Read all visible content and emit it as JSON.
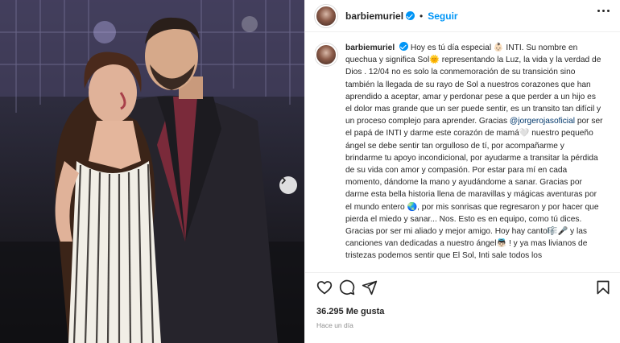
{
  "post": {
    "username": "barbiemuriel",
    "follow_label": "Seguir",
    "dot": "•",
    "caption_before_mention": "Hoy es tú día especial 👶🏻 INTI. Su nombre en quechua y significa Sol🌞 representando la Luz, la vida y la verdad de Dios . 12/04 no es solo la conmemoración de su transición sino también la llegada de su rayo de Sol a nuestros corazones que han aprendido a aceptar, amar y perdonar pese a que perder a un hijo es el dolor mas grande que un ser puede sentir, es un transito tan difícil y un proceso complejo para aprender. Gracias ",
    "mention": "@jorgerojasoficial",
    "caption_after_mention": " por ser el papá de INTI y darme este corazón de mamá🤍 nuestro pequeño ángel se debe sentir tan orgulloso de tí, por acompañarme y brindarme tu apoyo incondicional, por ayudarme a transitar la pérdida de su vida con amor y compasión. Por estar para mí en cada momento, dándome la mano y ayudándome a sanar. Gracias por darme esta bella historia llena de maravillas y mágicas aventuras por el mundo entero 🌏, por mis sonrisas que regresaron y por hacer que pierda el miedo y sanar... Nos. Esto es en equipo, como tú dices. Gracias por ser mi aliado y mejor amigo. Hoy hay canto🎼🎤 y las canciones van dedicadas a nuestro ángel👼🏻 ! y ya mas livianos de tristezas podemos sentir que El Sol, Inti sale todos los",
    "likes": "36.295 Me gusta",
    "time": "Hace un día"
  },
  "icons": {
    "header": [
      "verified-badge-icon",
      "more-options-icon"
    ],
    "photo": [
      "carousel-next-icon"
    ],
    "actions": [
      "heart-icon",
      "comment-icon",
      "share-icon",
      "bookmark-icon"
    ]
  },
  "colors": {
    "accent": "#0095f6",
    "text": "#262626",
    "muted": "#8e8e8e",
    "mention": "#00376b",
    "border": "#efefef"
  }
}
